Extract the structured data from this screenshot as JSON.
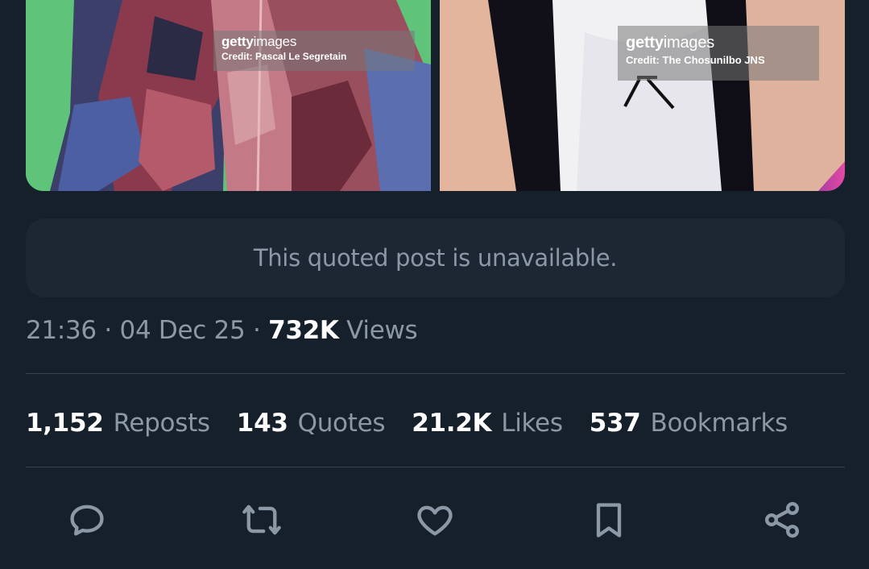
{
  "media": [
    {
      "watermark_brand_bold": "getty",
      "watermark_brand_light": "images",
      "credit": "Credit: Pascal Le Segretain"
    },
    {
      "watermark_brand_bold": "getty",
      "watermark_brand_light": "images",
      "credit": "Credit: The Chosunilbo JNS"
    }
  ],
  "quoted_post": {
    "text": "This quoted post is unavailable."
  },
  "meta": {
    "time": "21:36",
    "sep1": " · ",
    "date": "04 Dec 25",
    "sep2": " · ",
    "views_count": "732K",
    "views_label": " Views"
  },
  "stats": [
    {
      "count": "1,152",
      "label": "Reposts"
    },
    {
      "count": "143",
      "label": "Quotes"
    },
    {
      "count": "21.2K",
      "label": "Likes"
    },
    {
      "count": "537",
      "label": "Bookmarks"
    }
  ],
  "actions": [
    {
      "icon": "reply-icon"
    },
    {
      "icon": "repost-icon"
    },
    {
      "icon": "like-icon"
    },
    {
      "icon": "bookmark-icon"
    },
    {
      "icon": "share-icon"
    }
  ],
  "colors": {
    "background": "#15202b",
    "card": "#1c2733",
    "divider": "#38444d",
    "secondary_text": "#8b98a5",
    "primary_text": "#ffffff"
  }
}
